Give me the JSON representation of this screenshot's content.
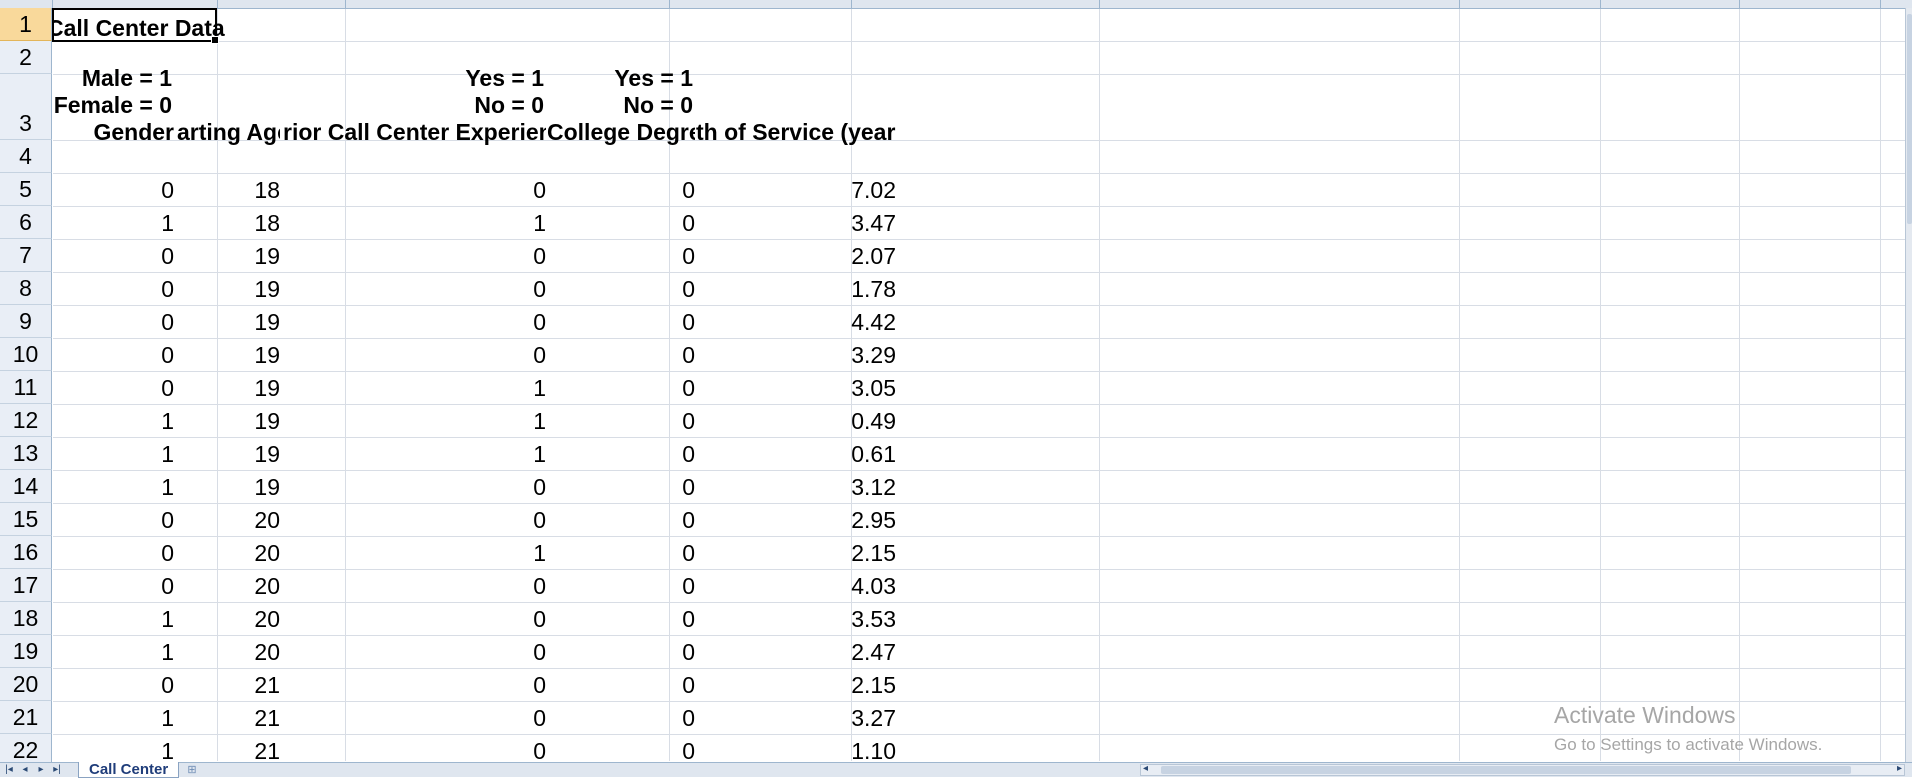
{
  "sheet": {
    "title": "Call Center Data",
    "tab_name": "Call Center",
    "row_numbers": [
      "1",
      "2",
      "3",
      "4",
      "5",
      "6",
      "7",
      "8",
      "9",
      "10",
      "11",
      "12",
      "13",
      "14",
      "15",
      "16",
      "17",
      "18",
      "19",
      "20",
      "21",
      "22"
    ],
    "legend_row3": {
      "gender_top": "Male = 1",
      "gender_bottom": "Female = 0",
      "experience_top": "Yes = 1",
      "experience_bottom": "No = 0",
      "degree_top": "Yes = 1",
      "degree_bottom": "No = 0"
    },
    "columns_visible": [
      "Gender",
      "arting Age",
      "rior Call Center Experience",
      "College Degree",
      "th of Service (years)"
    ],
    "columns_full": [
      "Gender",
      "Starting Age",
      "Prior Call Center Experience",
      "College Degree",
      "Length of Service (years)"
    ],
    "rows": [
      [
        "0",
        "18",
        "0",
        "0",
        "7.02"
      ],
      [
        "1",
        "18",
        "1",
        "0",
        "3.47"
      ],
      [
        "0",
        "19",
        "0",
        "0",
        "2.07"
      ],
      [
        "0",
        "19",
        "0",
        "0",
        "1.78"
      ],
      [
        "0",
        "19",
        "0",
        "0",
        "4.42"
      ],
      [
        "0",
        "19",
        "0",
        "0",
        "3.29"
      ],
      [
        "0",
        "19",
        "1",
        "0",
        "3.05"
      ],
      [
        "1",
        "19",
        "1",
        "0",
        "0.49"
      ],
      [
        "1",
        "19",
        "1",
        "0",
        "0.61"
      ],
      [
        "1",
        "19",
        "0",
        "0",
        "3.12"
      ],
      [
        "0",
        "20",
        "0",
        "0",
        "2.95"
      ],
      [
        "0",
        "20",
        "1",
        "0",
        "2.15"
      ],
      [
        "0",
        "20",
        "0",
        "0",
        "4.03"
      ],
      [
        "1",
        "20",
        "0",
        "0",
        "3.53"
      ],
      [
        "1",
        "20",
        "0",
        "0",
        "2.47"
      ],
      [
        "0",
        "21",
        "0",
        "0",
        "2.15"
      ],
      [
        "1",
        "21",
        "0",
        "0",
        "3.27"
      ],
      [
        "1",
        "21",
        "0",
        "0",
        "1.10"
      ]
    ]
  },
  "watermark": {
    "line1": "Activate Windows",
    "line2": "Go to Settings to activate Windows."
  },
  "colors": {
    "header_bg": "#e9eef6",
    "selected_row_header": "#f9d99b",
    "gridline": "#d8dde5"
  }
}
